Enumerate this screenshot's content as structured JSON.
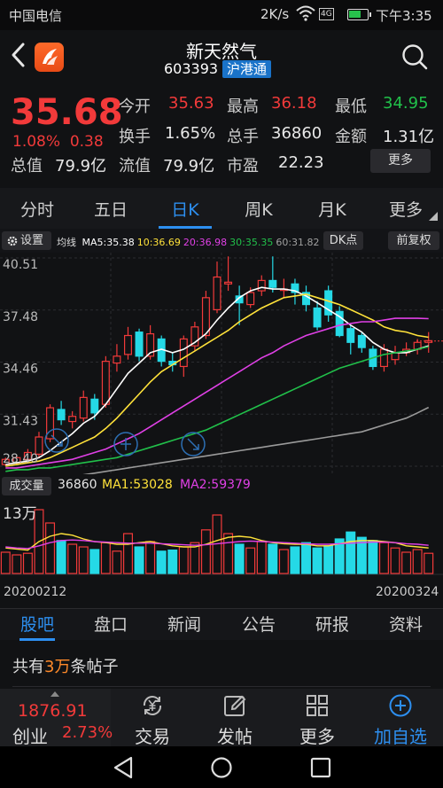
{
  "status_bar": {
    "carrier": "中国电信",
    "net_speed": "2K/s",
    "signal_label": "4G",
    "time": "下午3:35"
  },
  "header": {
    "name": "新天然气",
    "code": "603393",
    "badge": "沪港通"
  },
  "quote": {
    "price": "35.68",
    "change_pct": "1.08%",
    "change": "0.38",
    "rows": [
      [
        {
          "label": "今开",
          "value": "35.63",
          "color": "red"
        },
        {
          "label": "最高",
          "value": "36.18",
          "color": "red"
        },
        {
          "label": "最低",
          "value": "34.95",
          "color": "green"
        }
      ],
      [
        {
          "label": "换手",
          "value": "1.65%",
          "color": "white"
        },
        {
          "label": "总手",
          "value": "36860",
          "color": "white"
        },
        {
          "label": "金额",
          "value": "1.31亿",
          "color": "white"
        }
      ],
      [
        {
          "label": "总值",
          "value": "79.9亿",
          "color": "white"
        },
        {
          "label": "流值",
          "value": "79.9亿",
          "color": "white"
        },
        {
          "label": "市盈",
          "sup": "动",
          "value": "22.23",
          "color": "white"
        }
      ]
    ],
    "more_label": "更多"
  },
  "period_tabs": [
    "分时",
    "五日",
    "日K",
    "周K",
    "月K",
    "更多"
  ],
  "active_period": 2,
  "indicator_bar": {
    "settings": "设置",
    "ma_title": "均线",
    "ma": [
      {
        "label": "MA5:35.38",
        "color": "#ffffff"
      },
      {
        "label": "10:36.69",
        "color": "#ffe23a"
      },
      {
        "label": "20:36.98",
        "color": "#e040e6"
      },
      {
        "label": "30:35.35",
        "color": "#21c04a"
      },
      {
        "label": "60:31.82",
        "color": "#a0a0a0"
      }
    ],
    "dk": "DK点",
    "adjust": "前复权"
  },
  "chart_data": {
    "type": "candlestick",
    "y_ticks": [
      "40.51",
      "37.48",
      "34.46",
      "31.43",
      "28.40"
    ],
    "ylim": [
      28.4,
      40.51
    ],
    "candles": [
      {
        "o": 28.5,
        "c": 28.8,
        "h": 28.9,
        "l": 28.4
      },
      {
        "o": 28.6,
        "c": 28.9,
        "h": 29.0,
        "l": 28.5
      },
      {
        "o": 28.8,
        "c": 29.2,
        "h": 29.4,
        "l": 28.7
      },
      {
        "o": 29.1,
        "c": 30.1,
        "h": 30.4,
        "l": 28.9
      },
      {
        "o": 30.0,
        "c": 31.8,
        "h": 32.0,
        "l": 29.8
      },
      {
        "o": 31.7,
        "c": 31.1,
        "h": 32.2,
        "l": 30.8
      },
      {
        "o": 31.0,
        "c": 31.3,
        "h": 31.6,
        "l": 30.6
      },
      {
        "o": 31.2,
        "c": 32.4,
        "h": 32.8,
        "l": 31.0
      },
      {
        "o": 32.3,
        "c": 31.5,
        "h": 32.6,
        "l": 31.1
      },
      {
        "o": 32.0,
        "c": 34.5,
        "h": 34.8,
        "l": 31.8
      },
      {
        "o": 34.4,
        "c": 34.8,
        "h": 35.5,
        "l": 33.9
      },
      {
        "o": 34.9,
        "c": 36.0,
        "h": 36.5,
        "l": 34.6
      },
      {
        "o": 36.2,
        "c": 34.8,
        "h": 36.4,
        "l": 34.5
      },
      {
        "o": 34.8,
        "c": 36.1,
        "h": 36.6,
        "l": 34.6
      },
      {
        "o": 35.8,
        "c": 34.5,
        "h": 36.0,
        "l": 34.2
      },
      {
        "o": 34.5,
        "c": 34.3,
        "h": 35.0,
        "l": 33.9
      },
      {
        "o": 34.2,
        "c": 35.8,
        "h": 36.0,
        "l": 33.6
      },
      {
        "o": 35.4,
        "c": 36.5,
        "h": 36.8,
        "l": 35.1
      },
      {
        "o": 36.0,
        "c": 38.2,
        "h": 38.6,
        "l": 35.8
      },
      {
        "o": 37.5,
        "c": 39.4,
        "h": 40.3,
        "l": 37.3
      },
      {
        "o": 39.0,
        "c": 39.1,
        "h": 40.6,
        "l": 38.6
      },
      {
        "o": 38.3,
        "c": 37.9,
        "h": 38.9,
        "l": 36.6
      },
      {
        "o": 37.8,
        "c": 38.5,
        "h": 38.8,
        "l": 37.6
      },
      {
        "o": 38.6,
        "c": 39.2,
        "h": 39.5,
        "l": 38.3
      },
      {
        "o": 39.2,
        "c": 38.8,
        "h": 40.6,
        "l": 38.5
      },
      {
        "o": 38.7,
        "c": 38.7,
        "h": 39.3,
        "l": 38.2
      },
      {
        "o": 39.0,
        "c": 38.5,
        "h": 39.3,
        "l": 37.8
      },
      {
        "o": 38.5,
        "c": 37.8,
        "h": 38.9,
        "l": 37.4
      },
      {
        "o": 37.6,
        "c": 36.5,
        "h": 38.0,
        "l": 36.3
      },
      {
        "o": 38.6,
        "c": 37.2,
        "h": 38.9,
        "l": 36.8
      },
      {
        "o": 37.4,
        "c": 36.0,
        "h": 37.7,
        "l": 35.9
      },
      {
        "o": 36.4,
        "c": 35.6,
        "h": 36.6,
        "l": 34.9
      },
      {
        "o": 36.0,
        "c": 35.3,
        "h": 36.2,
        "l": 35.0
      },
      {
        "o": 35.2,
        "c": 34.2,
        "h": 35.4,
        "l": 34.0
      },
      {
        "o": 34.2,
        "c": 35.2,
        "h": 35.5,
        "l": 33.9
      },
      {
        "o": 34.6,
        "c": 35.0,
        "h": 35.4,
        "l": 34.3
      },
      {
        "o": 35.0,
        "c": 35.2,
        "h": 35.6,
        "l": 34.8
      },
      {
        "o": 35.2,
        "c": 35.6,
        "h": 35.8,
        "l": 34.9
      },
      {
        "o": 35.6,
        "c": 35.7,
        "h": 36.2,
        "l": 35.0
      }
    ],
    "ma_series": [
      {
        "name": "MA5",
        "color": "#ffffff",
        "values": [
          28.5,
          28.6,
          28.7,
          28.9,
          29.3,
          29.8,
          30.3,
          30.9,
          31.3,
          32.0,
          32.9,
          33.8,
          34.4,
          35.0,
          35.2,
          35.0,
          35.2,
          35.6,
          36.1,
          36.9,
          37.6,
          38.2,
          38.6,
          38.8,
          38.7,
          38.7,
          38.6,
          38.3,
          37.9,
          37.5,
          37.1,
          36.6,
          36.2,
          35.6,
          35.2,
          35.0,
          35.0,
          35.2,
          35.4
        ]
      },
      {
        "name": "MA10",
        "color": "#ffe23a",
        "values": [
          28.4,
          28.5,
          28.6,
          28.7,
          28.9,
          29.2,
          29.5,
          29.8,
          30.1,
          30.6,
          31.2,
          31.9,
          32.6,
          33.3,
          33.9,
          34.3,
          34.7,
          35.1,
          35.5,
          35.9,
          36.3,
          36.8,
          37.2,
          37.6,
          37.9,
          38.2,
          38.3,
          38.4,
          38.2,
          38.0,
          37.8,
          37.5,
          37.2,
          36.9,
          36.5,
          36.3,
          36.2,
          36.0,
          35.9
        ]
      },
      {
        "name": "MA20",
        "color": "#e040e6",
        "values": [
          28.3,
          28.3,
          28.4,
          28.5,
          28.6,
          28.7,
          28.8,
          29.0,
          29.2,
          29.4,
          29.7,
          30.0,
          30.3,
          30.7,
          31.1,
          31.5,
          31.9,
          32.3,
          32.7,
          33.1,
          33.5,
          33.9,
          34.3,
          34.7,
          35.0,
          35.4,
          35.7,
          36.0,
          36.2,
          36.4,
          36.6,
          36.7,
          36.8,
          36.8,
          36.9,
          37.0,
          37.0,
          37.0,
          36.98
        ]
      },
      {
        "name": "MA30",
        "color": "#21c04a",
        "values": [
          28.1,
          28.2,
          28.2,
          28.3,
          28.3,
          28.4,
          28.5,
          28.6,
          28.7,
          28.8,
          28.9,
          29.1,
          29.3,
          29.5,
          29.7,
          29.9,
          30.1,
          30.3,
          30.5,
          30.8,
          31.1,
          31.4,
          31.7,
          32.0,
          32.3,
          32.6,
          32.9,
          33.2,
          33.5,
          33.8,
          34.1,
          34.3,
          34.5,
          34.7,
          34.9,
          35.0,
          35.1,
          35.2,
          35.35
        ]
      },
      {
        "name": "MA60",
        "color": "#9a9a9a",
        "values": [
          27.2,
          27.3,
          27.4,
          27.5,
          27.6,
          27.7,
          27.8,
          27.9,
          28.0,
          28.1,
          28.2,
          28.3,
          28.4,
          28.5,
          28.6,
          28.7,
          28.8,
          28.9,
          29.0,
          29.1,
          29.2,
          29.3,
          29.4,
          29.5,
          29.6,
          29.7,
          29.8,
          29.9,
          30.0,
          30.1,
          30.2,
          30.3,
          30.4,
          30.6,
          30.8,
          31.0,
          31.2,
          31.5,
          31.82
        ]
      }
    ],
    "volume": {
      "label": "成交量",
      "value": "36860",
      "ma1": [
        48,
        46,
        44,
        60,
        70,
        75,
        72,
        65,
        60,
        58,
        55,
        55,
        58,
        60,
        56,
        52,
        50,
        50,
        55,
        62,
        68,
        70,
        68,
        62,
        58,
        56,
        55,
        55,
        52,
        52,
        56,
        60,
        62,
        62,
        60,
        58,
        52,
        50,
        48
      ],
      "ma2": [
        50,
        48,
        47,
        52,
        58,
        62,
        63,
        62,
        60,
        59,
        58,
        57,
        57,
        57,
        56,
        55,
        54,
        53,
        54,
        56,
        58,
        60,
        61,
        60,
        59,
        58,
        57,
        56,
        55,
        55,
        56,
        57,
        58,
        59,
        59,
        58,
        56,
        55,
        53
      ],
      "ymax_label": "13万",
      "values": [
        40,
        35,
        38,
        120,
        95,
        62,
        55,
        50,
        45,
        58,
        42,
        75,
        50,
        60,
        42,
        44,
        50,
        58,
        82,
        110,
        75,
        55,
        48,
        60,
        55,
        45,
        50,
        58,
        48,
        52,
        65,
        78,
        68,
        62,
        58,
        48,
        40,
        45,
        38
      ],
      "start_date": "20200212",
      "end_date": "20200324"
    }
  },
  "content_tabs": [
    "股吧",
    "盘口",
    "新闻",
    "公告",
    "研报",
    "资料"
  ],
  "active_content_tab": 0,
  "posts": {
    "prefix": "共有",
    "count": "3万",
    "suffix": "条帖子"
  },
  "bottom_bar": {
    "index_value": "1876.91",
    "index_name": "创业",
    "index_pct": "2.73%",
    "nav": [
      {
        "label": "交易",
        "icon": "yuan-refresh-icon"
      },
      {
        "label": "发帖",
        "icon": "edit-icon"
      },
      {
        "label": "更多",
        "icon": "grid-icon"
      },
      {
        "label": "加自选",
        "icon": "plus-circle-icon"
      }
    ]
  }
}
